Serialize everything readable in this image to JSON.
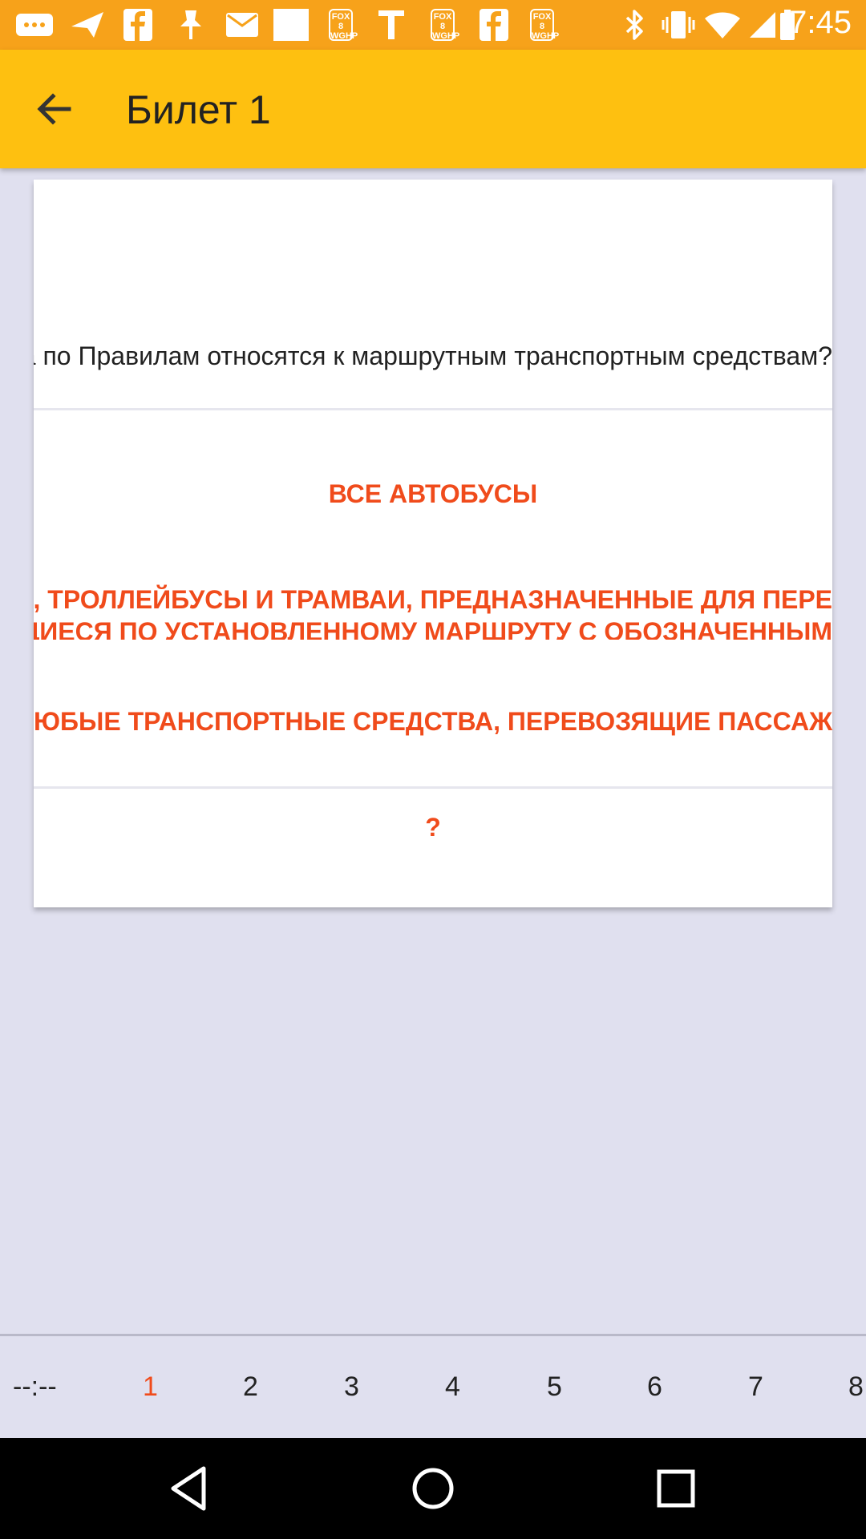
{
  "status_bar": {
    "time": "7:45",
    "notification_icons": [
      "more-icon",
      "send-icon",
      "facebook-icon",
      "pin-icon",
      "mail-icon",
      "blank-icon",
      "fox8-icon",
      "text-icon",
      "fox8-icon",
      "facebook-icon",
      "fox8-icon"
    ],
    "fox_label": "FOX 8 WGHP",
    "status_icons": [
      "bluetooth-icon",
      "vibrate-icon",
      "wifi-icon",
      "signal-icon",
      "battery-icon"
    ]
  },
  "app_bar": {
    "title": "Билет 1"
  },
  "card": {
    "question": "Какие транспортные средства по Правилам относятся к маршрутным транспортным средствам?",
    "answers": [
      {
        "text": "ВСЕ АВТОБУСЫ"
      },
      {
        "line1": "АВТОБУСЫ, ТРОЛЛЕЙБУСЫ И ТРАМВАИ, ПРЕДНАЗНАЧЕННЫЕ ДЛЯ ПЕРЕ",
        "line2": "И ДВИЖУЩИЕСЯ ПО УСТАНОВЛЕННОМУ МАРШРУТУ С ОБОЗНАЧЕННЫМ"
      },
      {
        "text": "ЛЮБЫЕ ТРАНСПОРТНЫЕ СРЕДСТВА, ПЕРЕВОЗЯЩИЕ ПАССАЖ"
      }
    ],
    "hint": "?"
  },
  "tabs": {
    "timer": "--:--",
    "items": [
      "1",
      "2",
      "3",
      "4",
      "5",
      "6",
      "7",
      "8"
    ],
    "active": "1"
  },
  "colors": {
    "status_bar": "#f7a21a",
    "app_bar": "#fec010",
    "accent": "#f04b1b",
    "background": "#e0e0ef"
  }
}
